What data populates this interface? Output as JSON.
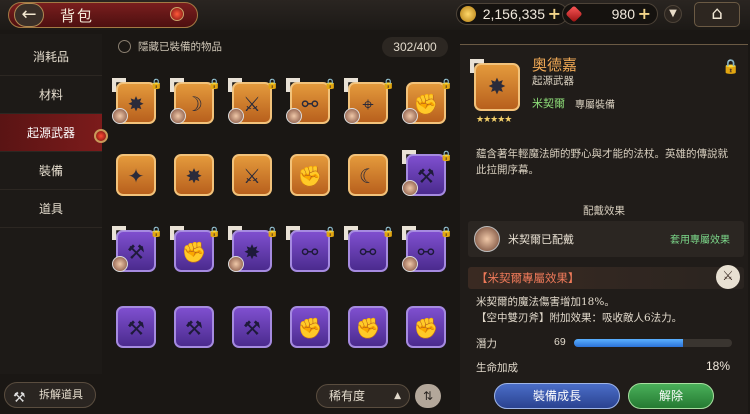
{
  "header": {
    "title": "背包",
    "back_icon": "arrow-left-icon"
  },
  "resources": {
    "gold": "2,156,335",
    "gems": "980",
    "plus": "+"
  },
  "nav": {
    "items": [
      "消耗品",
      "材料",
      "起源武器",
      "裝備",
      "道具"
    ],
    "active_index": 2,
    "dismantle_label": "拆解道具"
  },
  "inventory": {
    "hide_equipped_label": "隱藏已裝備的物品",
    "count": "302/400",
    "sort_label": "稀有度",
    "rows": [
      [
        {
          "r": "orange",
          "icon": "staff-icon",
          "avatar": true,
          "lock": true,
          "mark": true
        },
        {
          "r": "orange",
          "icon": "scythe-icon",
          "avatar": true,
          "lock": true,
          "mark": true
        },
        {
          "r": "orange",
          "icon": "crossbow-icon",
          "avatar": true,
          "lock": true,
          "mark": true
        },
        {
          "r": "orange",
          "icon": "chain-icon",
          "avatar": true,
          "lock": true,
          "mark": true
        },
        {
          "r": "orange",
          "icon": "gun-icon",
          "avatar": true,
          "lock": true,
          "mark": true
        },
        {
          "r": "orange",
          "icon": "gauntlet-icon",
          "avatar": true,
          "lock": true,
          "mark": false
        }
      ],
      [
        {
          "r": "orange",
          "icon": "shuriken-icon",
          "avatar": false,
          "lock": false,
          "mark": false
        },
        {
          "r": "orange",
          "icon": "staff-icon",
          "avatar": false,
          "lock": false,
          "mark": false
        },
        {
          "r": "orange",
          "icon": "sword-icon",
          "avatar": false,
          "lock": false,
          "mark": false
        },
        {
          "r": "orange",
          "icon": "gauntlet-icon",
          "avatar": false,
          "lock": false,
          "mark": false
        },
        {
          "r": "orange",
          "icon": "bow-icon",
          "avatar": false,
          "lock": false,
          "mark": false
        },
        {
          "r": "purple",
          "icon": "axe-icon",
          "avatar": true,
          "lock": true,
          "mark": true
        }
      ],
      [
        {
          "r": "purple",
          "icon": "axe-icon",
          "avatar": true,
          "lock": true,
          "mark": true
        },
        {
          "r": "purple",
          "icon": "gauntlet-icon",
          "avatar": false,
          "lock": true,
          "mark": true
        },
        {
          "r": "purple",
          "icon": "staff-icon",
          "avatar": true,
          "lock": true,
          "mark": true
        },
        {
          "r": "purple",
          "icon": "chain-icon",
          "avatar": false,
          "lock": true,
          "mark": true
        },
        {
          "r": "purple",
          "icon": "chain-icon",
          "avatar": false,
          "lock": true,
          "mark": true
        },
        {
          "r": "purple",
          "icon": "chain-icon",
          "avatar": true,
          "lock": true,
          "mark": true
        }
      ],
      [
        {
          "r": "purple",
          "icon": "axe-icon",
          "avatar": false,
          "lock": false,
          "mark": false
        },
        {
          "r": "purple",
          "icon": "axe-icon",
          "avatar": false,
          "lock": false,
          "mark": false
        },
        {
          "r": "purple",
          "icon": "axe-icon",
          "avatar": false,
          "lock": false,
          "mark": false
        },
        {
          "r": "purple",
          "icon": "gauntlet-icon",
          "avatar": false,
          "lock": false,
          "mark": false
        },
        {
          "r": "purple",
          "icon": "gauntlet-icon",
          "avatar": false,
          "lock": false,
          "mark": false
        },
        {
          "r": "purple",
          "icon": "gauntlet-icon",
          "avatar": false,
          "lock": false,
          "mark": false
        }
      ]
    ]
  },
  "detail": {
    "name": "奧德嘉",
    "type": "起源武器",
    "owner": "米契爾",
    "owner_suffix": "專屬裝備",
    "stars": "★★★★★",
    "description": "蘊含著年輕魔法師的野心與才能的法杖。英雄的傳說就此拉開序幕。",
    "equip_section_title": "配戴效果",
    "equipped_text": "米契爾已配戴",
    "apply_exclusive_label": "套用專屬效果",
    "exclusive_title": "【米契爾專屬效果】",
    "exclusive_desc_1": "米契爾的魔法傷害增加18%。",
    "exclusive_desc_2": "【空中雙刃斧】附加效果：吸收敵人6法力。",
    "potential_label": "潛力",
    "potential_value": "69",
    "potential_fill": 0.69,
    "hp_label": "生命加成",
    "hp_value": "18%",
    "grow_button": "裝備成長",
    "remove_button": "解除"
  },
  "colors": {
    "accent_red": "#7c1b1b",
    "rarity_orange": "#d88431",
    "rarity_purple": "#6a40b8",
    "owner_green": "#8fe07a"
  }
}
